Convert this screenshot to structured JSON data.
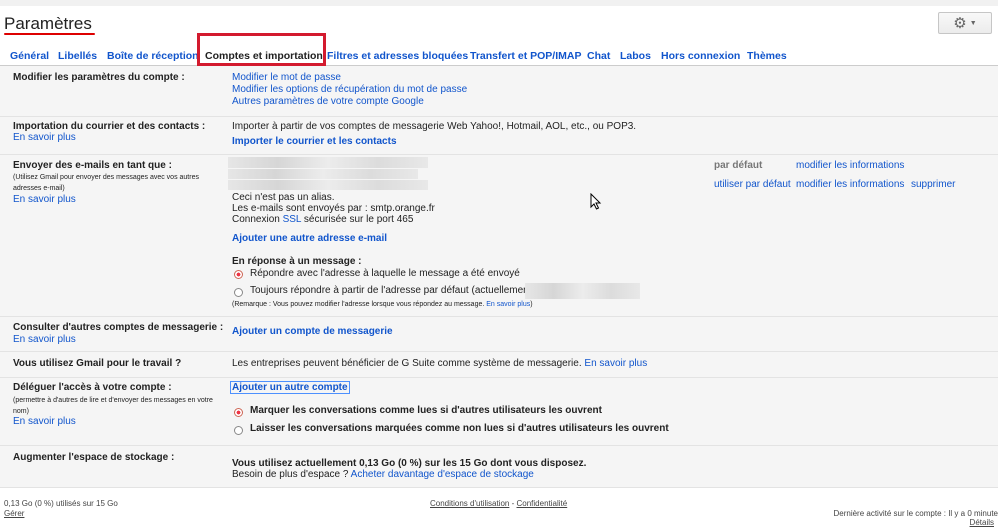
{
  "page_title": "Paramètres",
  "tabs": [
    "Général",
    "Libellés",
    "Boîte de réception",
    "Comptes et importation",
    "Filtres et adresses bloquées",
    "Transfert et POP/IMAP",
    "Chat",
    "Labos",
    "Hors connexion",
    "Thèmes"
  ],
  "sections": {
    "account": {
      "label": "Modifier les paramètres du compte :",
      "links": [
        "Modifier le mot de passe",
        "Modifier les options de récupération du mot de passe",
        "Autres paramètres de votre compte Google"
      ]
    },
    "import": {
      "label": "Importation du courrier et des contacts :",
      "learn_more": "En savoir plus",
      "text": "Importer à partir de vos comptes de messagerie Web Yahoo!, Hotmail, AOL, etc., ou POP3.",
      "action": "Importer le courrier et les contacts"
    },
    "send_as": {
      "label": "Envoyer des e-mails en tant que :",
      "note": "(Utilisez Gmail pour envoyer des messages avec vos autres adresses e-mail)",
      "learn_more": "En savoir plus",
      "default_label": "par défaut",
      "edit_info": "modifier les informations",
      "use_default": "utiliser par défaut",
      "edit_info_2": "modifier les informations",
      "delete": "supprimer",
      "not_alias": "Ceci n'est pas un alias.",
      "smtp": "Les e-mails sont envoyés par : smtp.orange.fr",
      "conn_pre": "Connexion",
      "ssl": "SSL",
      "conn_post": "sécurisée sur le port 465",
      "add_address": "Ajouter une autre adresse e-mail",
      "reply_heading": "En réponse à un message :",
      "reply_option_1": "Répondre avec l'adresse à laquelle le message a été envoyé",
      "reply_option_2": "Toujours répondre à partir de l'adresse par défaut (actuellement",
      "remark": "(Remarque : Vous pouvez modifier l'adresse lorsque vous répondez au message.",
      "remark_link": "En savoir plus",
      "remark_end": ")"
    },
    "check_mail": {
      "label": "Consulter d'autres comptes de messagerie :",
      "learn_more": "En savoir plus",
      "action": "Ajouter un compte de messagerie"
    },
    "work": {
      "label": "Vous utilisez Gmail pour le travail ?",
      "text": "Les entreprises peuvent bénéficier de G Suite comme système de messagerie.",
      "learn_more": "En savoir plus"
    },
    "delegate": {
      "label": "Déléguer l'accès à votre compte :",
      "note": "(permettre à d'autres de lire et d'envoyer des messages en votre nom)",
      "learn_more": "En savoir plus",
      "action": "Ajouter un autre compte",
      "option_1": "Marquer les conversations comme lues si d'autres utilisateurs les ouvrent",
      "option_2": "Laisser les conversations marquées comme non lues si d'autres utilisateurs les ouvrent"
    },
    "storage": {
      "label": "Augmenter l'espace de stockage :",
      "usage": "Vous utilisez actuellement 0,13 Go (0 %) sur les 15 Go dont vous disposez.",
      "more_q": "Besoin de plus d'espace ?",
      "buy": "Acheter davantage d'espace de stockage"
    }
  },
  "footer": {
    "usage": "0,13 Go (0 %) utilisés sur 15 Go",
    "manage": "Gérer",
    "terms": "Conditions d'utilisation",
    "sep": "-",
    "privacy": "Confidentialité",
    "last_activity": "Dernière activité sur le compte : Il y a 0 minute",
    "details": "Détails"
  },
  "icons": {
    "settings": "gear-icon",
    "dropdown": "caret-down-icon",
    "pointer": "mouse-cursor-icon"
  },
  "colors": {
    "link": "#1155cc",
    "highlight": "#d31a2e",
    "radio_on": "#ee3344"
  }
}
